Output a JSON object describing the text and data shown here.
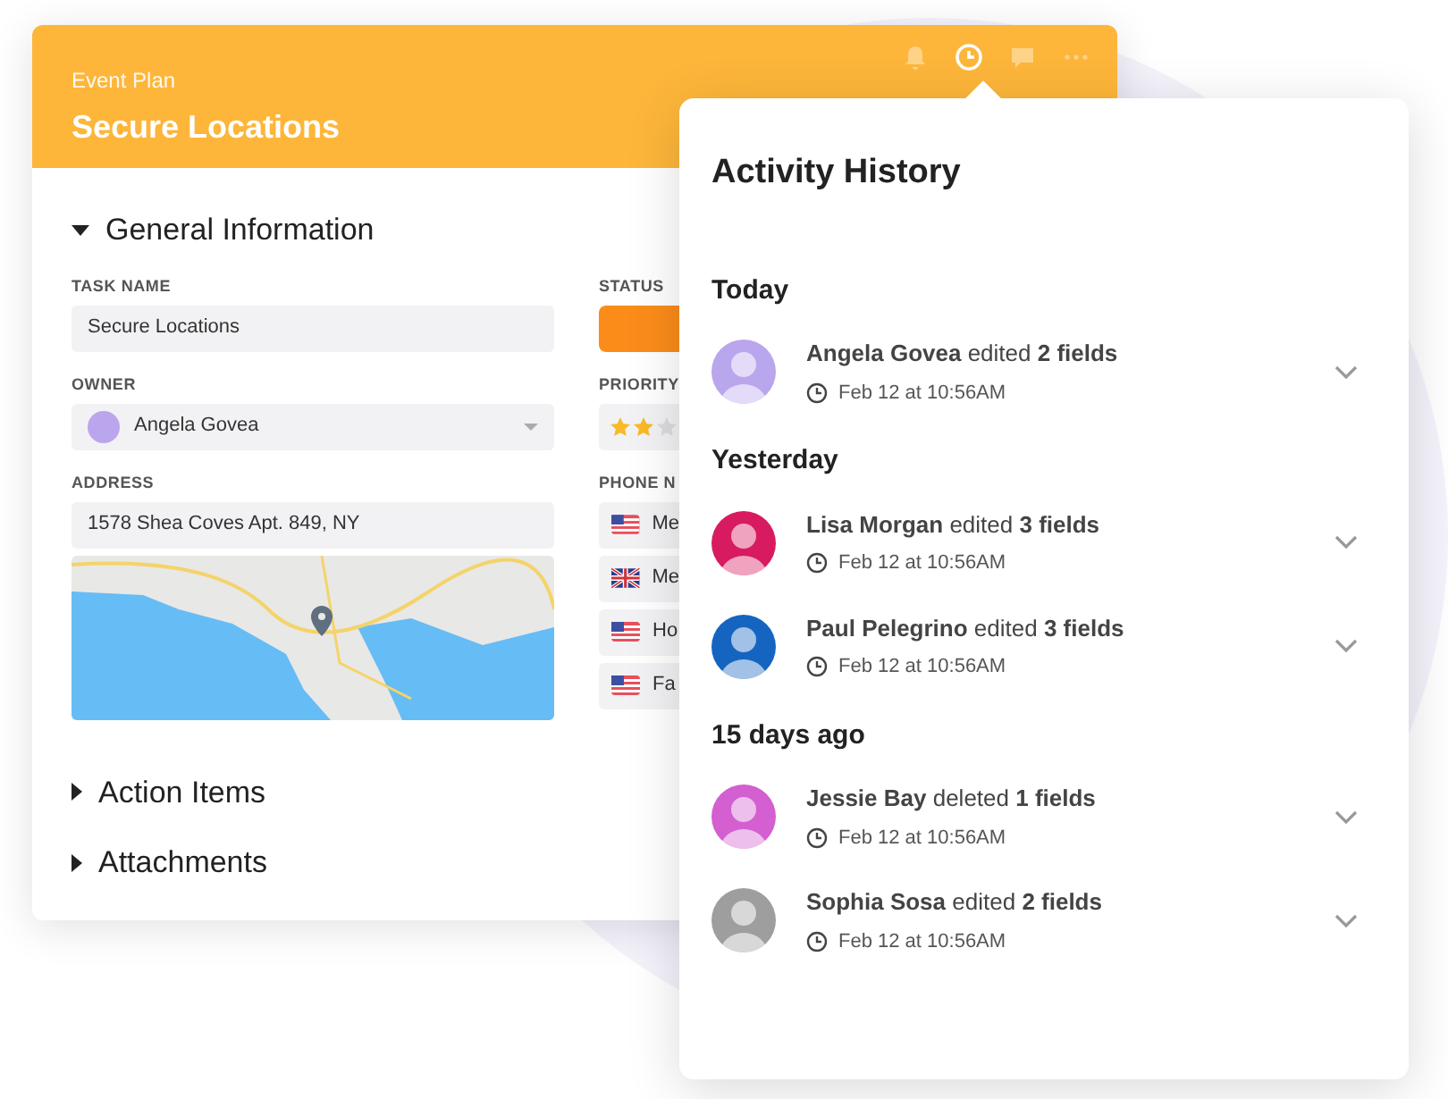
{
  "card": {
    "header": {
      "subtitle": "Event Plan",
      "title": "Secure Locations",
      "tools": [
        {
          "kind": "bell",
          "selected": false
        },
        {
          "kind": "clock",
          "selected": true
        },
        {
          "kind": "chat",
          "selected": false
        },
        {
          "kind": "more",
          "selected": false
        }
      ]
    },
    "sections": [
      {
        "title": "General Information",
        "expanded": true
      },
      {
        "title": "Action Items",
        "expanded": false
      },
      {
        "title": "Attachments",
        "expanded": false
      }
    ],
    "task_name": {
      "label": "TASK NAME",
      "value": "Secure Locations"
    },
    "owner": {
      "label": "OWNER",
      "value": "Angela Govea"
    },
    "address": {
      "label": "ADDRESS",
      "value": "1578 Shea Coves Apt. 849, NY"
    },
    "status": {
      "label": "STATUS"
    },
    "priority": {
      "label": "PRIORITY",
      "stars": 2
    },
    "phone_numbers": {
      "label": "PHONE N",
      "items": [
        {
          "kind": "us",
          "text": "Me"
        },
        {
          "kind": "uk",
          "text": "Me"
        },
        {
          "kind": "us",
          "text": "Ho"
        },
        {
          "kind": "us",
          "text": "Fa"
        }
      ]
    }
  },
  "activity_history": {
    "title": "Activity History",
    "groups": [
      {
        "title": "Today",
        "entries": [
          {
            "text": "**Angela Govea** edited **2 fields**",
            "time": "Feb 12 at 10:56AM",
            "color": "#b9a6ec"
          }
        ]
      },
      {
        "title": "Yesterday",
        "entries": [
          {
            "text": "**Lisa Morgan** edited **3 fields**",
            "time": "Feb 12 at 10:56AM",
            "color": "#d81b60"
          },
          {
            "text": "**Paul Pelegrino** edited **3 fields**",
            "time": "Feb 12 at 10:56AM",
            "color": "#1565c0"
          }
        ]
      },
      {
        "title": "15 days ago",
        "entries": [
          {
            "text": "**Jessie Bay** deleted **1 fields**",
            "time": "Feb 12 at 10:56AM",
            "color": "#d35fd0"
          },
          {
            "text": "**Sophia Sosa** edited **2 fields**",
            "time": "Feb 12 at 10:56AM",
            "color": "#9e9e9e"
          }
        ]
      }
    ]
  }
}
